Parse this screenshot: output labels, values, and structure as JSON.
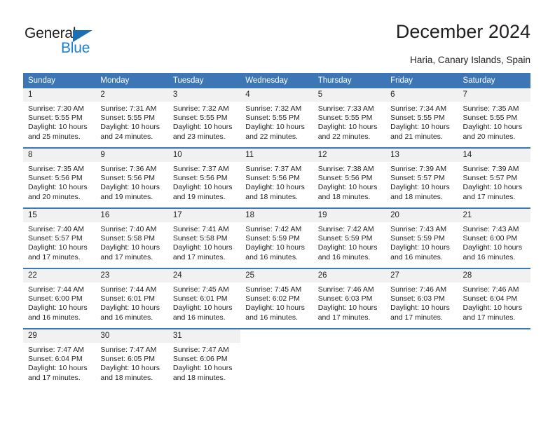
{
  "logo": {
    "word1": "General",
    "word2": "Blue",
    "triangle_color": "#1a6fb5",
    "blue_color": "#1a7fd4"
  },
  "header": {
    "title": "December 2024",
    "subtitle": "Haria, Canary Islands, Spain"
  },
  "theme": {
    "header_bg": "#3d76b4",
    "header_text": "#ffffff",
    "daynum_bg": "#f1f1f1",
    "text": "#231f20"
  },
  "calendar": {
    "weekday_headers": [
      "Sunday",
      "Monday",
      "Tuesday",
      "Wednesday",
      "Thursday",
      "Friday",
      "Saturday"
    ],
    "labels": {
      "sunrise": "Sunrise:",
      "sunset": "Sunset:",
      "daylight": "Daylight:"
    },
    "weeks": [
      [
        {
          "day": "1",
          "sunrise": "Sunrise: 7:30 AM",
          "sunset": "Sunset: 5:55 PM",
          "daylight1": "Daylight: 10 hours",
          "daylight2": "and 25 minutes."
        },
        {
          "day": "2",
          "sunrise": "Sunrise: 7:31 AM",
          "sunset": "Sunset: 5:55 PM",
          "daylight1": "Daylight: 10 hours",
          "daylight2": "and 24 minutes."
        },
        {
          "day": "3",
          "sunrise": "Sunrise: 7:32 AM",
          "sunset": "Sunset: 5:55 PM",
          "daylight1": "Daylight: 10 hours",
          "daylight2": "and 23 minutes."
        },
        {
          "day": "4",
          "sunrise": "Sunrise: 7:32 AM",
          "sunset": "Sunset: 5:55 PM",
          "daylight1": "Daylight: 10 hours",
          "daylight2": "and 22 minutes."
        },
        {
          "day": "5",
          "sunrise": "Sunrise: 7:33 AM",
          "sunset": "Sunset: 5:55 PM",
          "daylight1": "Daylight: 10 hours",
          "daylight2": "and 22 minutes."
        },
        {
          "day": "6",
          "sunrise": "Sunrise: 7:34 AM",
          "sunset": "Sunset: 5:55 PM",
          "daylight1": "Daylight: 10 hours",
          "daylight2": "and 21 minutes."
        },
        {
          "day": "7",
          "sunrise": "Sunrise: 7:35 AM",
          "sunset": "Sunset: 5:55 PM",
          "daylight1": "Daylight: 10 hours",
          "daylight2": "and 20 minutes."
        }
      ],
      [
        {
          "day": "8",
          "sunrise": "Sunrise: 7:35 AM",
          "sunset": "Sunset: 5:56 PM",
          "daylight1": "Daylight: 10 hours",
          "daylight2": "and 20 minutes."
        },
        {
          "day": "9",
          "sunrise": "Sunrise: 7:36 AM",
          "sunset": "Sunset: 5:56 PM",
          "daylight1": "Daylight: 10 hours",
          "daylight2": "and 19 minutes."
        },
        {
          "day": "10",
          "sunrise": "Sunrise: 7:37 AM",
          "sunset": "Sunset: 5:56 PM",
          "daylight1": "Daylight: 10 hours",
          "daylight2": "and 19 minutes."
        },
        {
          "day": "11",
          "sunrise": "Sunrise: 7:37 AM",
          "sunset": "Sunset: 5:56 PM",
          "daylight1": "Daylight: 10 hours",
          "daylight2": "and 18 minutes."
        },
        {
          "day": "12",
          "sunrise": "Sunrise: 7:38 AM",
          "sunset": "Sunset: 5:56 PM",
          "daylight1": "Daylight: 10 hours",
          "daylight2": "and 18 minutes."
        },
        {
          "day": "13",
          "sunrise": "Sunrise: 7:39 AM",
          "sunset": "Sunset: 5:57 PM",
          "daylight1": "Daylight: 10 hours",
          "daylight2": "and 18 minutes."
        },
        {
          "day": "14",
          "sunrise": "Sunrise: 7:39 AM",
          "sunset": "Sunset: 5:57 PM",
          "daylight1": "Daylight: 10 hours",
          "daylight2": "and 17 minutes."
        }
      ],
      [
        {
          "day": "15",
          "sunrise": "Sunrise: 7:40 AM",
          "sunset": "Sunset: 5:57 PM",
          "daylight1": "Daylight: 10 hours",
          "daylight2": "and 17 minutes."
        },
        {
          "day": "16",
          "sunrise": "Sunrise: 7:40 AM",
          "sunset": "Sunset: 5:58 PM",
          "daylight1": "Daylight: 10 hours",
          "daylight2": "and 17 minutes."
        },
        {
          "day": "17",
          "sunrise": "Sunrise: 7:41 AM",
          "sunset": "Sunset: 5:58 PM",
          "daylight1": "Daylight: 10 hours",
          "daylight2": "and 17 minutes."
        },
        {
          "day": "18",
          "sunrise": "Sunrise: 7:42 AM",
          "sunset": "Sunset: 5:59 PM",
          "daylight1": "Daylight: 10 hours",
          "daylight2": "and 16 minutes."
        },
        {
          "day": "19",
          "sunrise": "Sunrise: 7:42 AM",
          "sunset": "Sunset: 5:59 PM",
          "daylight1": "Daylight: 10 hours",
          "daylight2": "and 16 minutes."
        },
        {
          "day": "20",
          "sunrise": "Sunrise: 7:43 AM",
          "sunset": "Sunset: 5:59 PM",
          "daylight1": "Daylight: 10 hours",
          "daylight2": "and 16 minutes."
        },
        {
          "day": "21",
          "sunrise": "Sunrise: 7:43 AM",
          "sunset": "Sunset: 6:00 PM",
          "daylight1": "Daylight: 10 hours",
          "daylight2": "and 16 minutes."
        }
      ],
      [
        {
          "day": "22",
          "sunrise": "Sunrise: 7:44 AM",
          "sunset": "Sunset: 6:00 PM",
          "daylight1": "Daylight: 10 hours",
          "daylight2": "and 16 minutes."
        },
        {
          "day": "23",
          "sunrise": "Sunrise: 7:44 AM",
          "sunset": "Sunset: 6:01 PM",
          "daylight1": "Daylight: 10 hours",
          "daylight2": "and 16 minutes."
        },
        {
          "day": "24",
          "sunrise": "Sunrise: 7:45 AM",
          "sunset": "Sunset: 6:01 PM",
          "daylight1": "Daylight: 10 hours",
          "daylight2": "and 16 minutes."
        },
        {
          "day": "25",
          "sunrise": "Sunrise: 7:45 AM",
          "sunset": "Sunset: 6:02 PM",
          "daylight1": "Daylight: 10 hours",
          "daylight2": "and 16 minutes."
        },
        {
          "day": "26",
          "sunrise": "Sunrise: 7:46 AM",
          "sunset": "Sunset: 6:03 PM",
          "daylight1": "Daylight: 10 hours",
          "daylight2": "and 17 minutes."
        },
        {
          "day": "27",
          "sunrise": "Sunrise: 7:46 AM",
          "sunset": "Sunset: 6:03 PM",
          "daylight1": "Daylight: 10 hours",
          "daylight2": "and 17 minutes."
        },
        {
          "day": "28",
          "sunrise": "Sunrise: 7:46 AM",
          "sunset": "Sunset: 6:04 PM",
          "daylight1": "Daylight: 10 hours",
          "daylight2": "and 17 minutes."
        }
      ],
      [
        {
          "day": "29",
          "sunrise": "Sunrise: 7:47 AM",
          "sunset": "Sunset: 6:04 PM",
          "daylight1": "Daylight: 10 hours",
          "daylight2": "and 17 minutes."
        },
        {
          "day": "30",
          "sunrise": "Sunrise: 7:47 AM",
          "sunset": "Sunset: 6:05 PM",
          "daylight1": "Daylight: 10 hours",
          "daylight2": "and 18 minutes."
        },
        {
          "day": "31",
          "sunrise": "Sunrise: 7:47 AM",
          "sunset": "Sunset: 6:06 PM",
          "daylight1": "Daylight: 10 hours",
          "daylight2": "and 18 minutes."
        },
        {
          "day": "",
          "sunrise": "",
          "sunset": "",
          "daylight1": "",
          "daylight2": ""
        },
        {
          "day": "",
          "sunrise": "",
          "sunset": "",
          "daylight1": "",
          "daylight2": ""
        },
        {
          "day": "",
          "sunrise": "",
          "sunset": "",
          "daylight1": "",
          "daylight2": ""
        },
        {
          "day": "",
          "sunrise": "",
          "sunset": "",
          "daylight1": "",
          "daylight2": ""
        }
      ]
    ]
  }
}
